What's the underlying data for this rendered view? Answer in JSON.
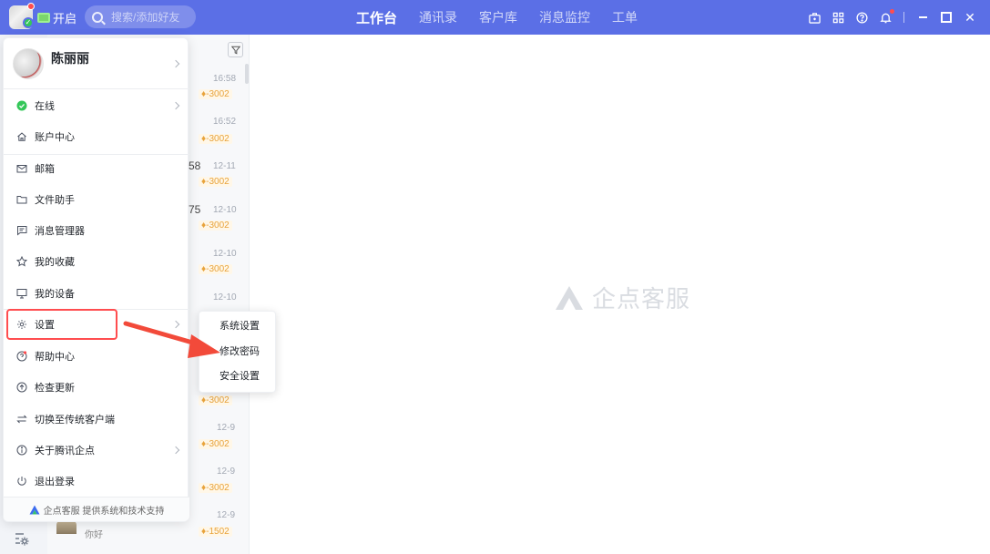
{
  "header": {
    "open_label": "开启",
    "search_placeholder": "搜索/添加好友",
    "nav": [
      {
        "label": "工作台",
        "active": true
      },
      {
        "label": "通讯录",
        "active": false
      },
      {
        "label": "客户库",
        "active": false
      },
      {
        "label": "消息监控",
        "active": false
      },
      {
        "label": "工单",
        "active": false
      }
    ]
  },
  "conversations": [
    {
      "time": "16:58",
      "tag": "-3002"
    },
    {
      "time": "16:52",
      "tag": "-3002"
    },
    {
      "time": "12-11",
      "tag": "-3002",
      "partial": "58"
    },
    {
      "time": "12-10",
      "tag": "-3002",
      "partial": "75"
    },
    {
      "time": "12-10",
      "tag": "-3002"
    },
    {
      "time": "12-10",
      "tag": ""
    },
    {
      "time": "",
      "tag": "-3002"
    },
    {
      "time": "12-9",
      "tag": "-3002"
    },
    {
      "time": "12-9",
      "tag": "-3002"
    },
    {
      "time": "12-9",
      "tag": "-1502",
      "message": "你好"
    }
  ],
  "menu": {
    "user_name": "陈丽丽",
    "items": [
      {
        "label": "在线",
        "icon": "online-status-icon",
        "has_arrow": true
      },
      {
        "label": "账户中心",
        "icon": "home-icon",
        "has_arrow": false
      },
      {
        "label": "邮箱",
        "icon": "mail-icon",
        "has_arrow": false
      },
      {
        "label": "文件助手",
        "icon": "folder-icon",
        "has_arrow": false
      },
      {
        "label": "消息管理器",
        "icon": "message-icon",
        "has_arrow": false
      },
      {
        "label": "我的收藏",
        "icon": "star-icon",
        "has_arrow": false
      },
      {
        "label": "我的设备",
        "icon": "monitor-icon",
        "has_arrow": false
      },
      {
        "label": "设置",
        "icon": "gear-icon",
        "has_arrow": true
      },
      {
        "label": "帮助中心",
        "icon": "help-icon",
        "has_arrow": false
      },
      {
        "label": "检查更新",
        "icon": "update-icon",
        "has_arrow": false
      },
      {
        "label": "切换至传统客户端",
        "icon": "switch-icon",
        "has_arrow": false
      },
      {
        "label": "关于腾讯企点",
        "icon": "info-icon",
        "has_arrow": true
      },
      {
        "label": "退出登录",
        "icon": "power-icon",
        "has_arrow": false
      }
    ],
    "footer": "企点客服 提供系统和技术支持"
  },
  "submenu": {
    "items": [
      "系统设置",
      "修改密码",
      "安全设置"
    ]
  },
  "watermark": "企点客服",
  "colors": {
    "header_bg": "#5b6fe6",
    "highlight": "#ff4d4f",
    "online": "#34c759",
    "tag": "#e8a33b"
  }
}
